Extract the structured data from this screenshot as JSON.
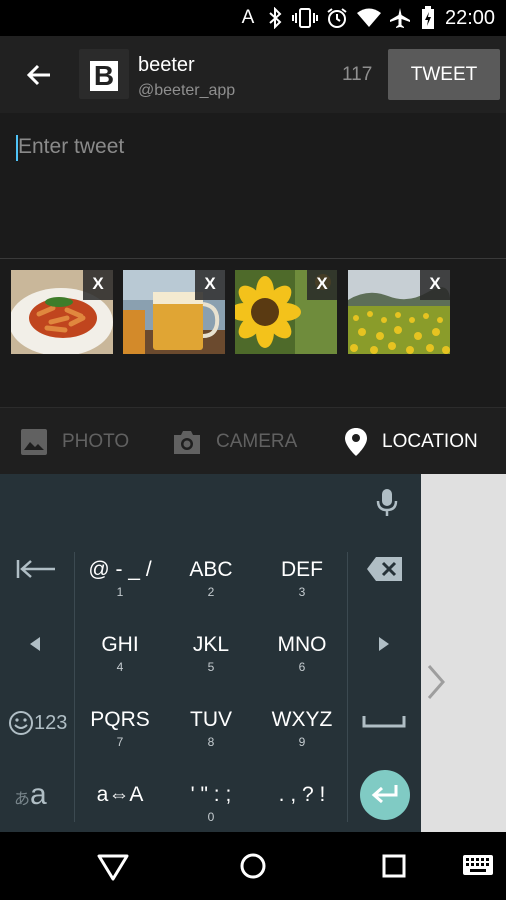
{
  "status_bar": {
    "time": "22:00",
    "indicator": "A",
    "icons": [
      "bluetooth-icon",
      "vibrate-icon",
      "alarm-icon",
      "wifi-icon",
      "airplane-icon",
      "battery-charging-icon"
    ]
  },
  "header": {
    "account_name": "beeter",
    "account_handle": "@beeter_app",
    "avatar_letter": "B",
    "char_count": "117",
    "tweet_button": "TWEET"
  },
  "compose": {
    "placeholder": "Enter tweet"
  },
  "attachments": [
    {
      "subject": "pasta",
      "remove_label": "X"
    },
    {
      "subject": "beer",
      "remove_label": "X"
    },
    {
      "subject": "sunflower",
      "remove_label": "X"
    },
    {
      "subject": "sunflower-field",
      "remove_label": "X"
    }
  ],
  "toolbar": {
    "photo": "PHOTO",
    "camera": "CAMERA",
    "location": "LOCATION",
    "active_color": "#ffffff",
    "inactive_color": "#616161"
  },
  "keyboard": {
    "rows": [
      [
        {
          "main": "@ - _ /",
          "sub": "1"
        },
        {
          "main": "ABC",
          "sub": "2"
        },
        {
          "main": "DEF",
          "sub": "3"
        }
      ],
      [
        {
          "main": "GHI",
          "sub": "4"
        },
        {
          "main": "JKL",
          "sub": "5"
        },
        {
          "main": "MNO",
          "sub": "6"
        }
      ],
      [
        {
          "main": "PQRS",
          "sub": "7"
        },
        {
          "main": "TUV",
          "sub": "8"
        },
        {
          "main": "WXYZ",
          "sub": "9"
        }
      ],
      [
        {
          "main": "a⇔A",
          "sub": ""
        },
        {
          "main": "' \" : ;",
          "sub": "0"
        },
        {
          "main": ". , ? !",
          "sub": ""
        }
      ]
    ],
    "left": {
      "mode_label": "123",
      "kana_label": "あ",
      "latin_label": "a"
    },
    "enter_color": "#80cbc4"
  }
}
